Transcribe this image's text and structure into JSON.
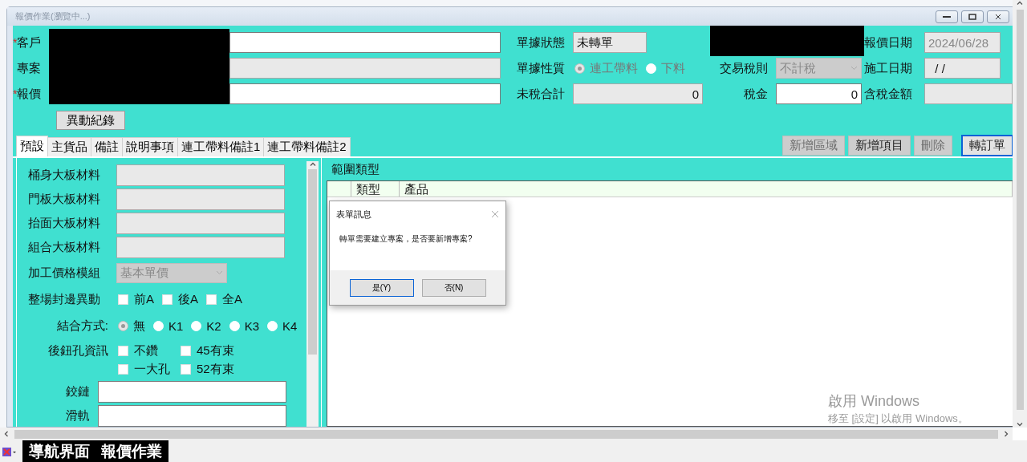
{
  "window": {
    "title": "報價作業(瀏覽中...)"
  },
  "header_fields": [
    {
      "marker": "*",
      "label": "客戶",
      "disabled": false
    },
    {
      "label": "專案",
      "disabled": true
    },
    {
      "marker": "*",
      "label": "報價",
      "disabled": false
    }
  ],
  "history_button": "異動紀錄",
  "status": {
    "label": "單據狀態",
    "value": "未轉單"
  },
  "quote_date": {
    "label": "報價日期",
    "value": "2024/06/28",
    "disabled": true
  },
  "doc_type": {
    "label": "單據性質",
    "disabled": true,
    "options": [
      {
        "label": "連工帶料",
        "selected": true
      },
      {
        "label": "下料",
        "selected": false
      }
    ]
  },
  "tax_rule": {
    "label": "交易稅則",
    "value": "不計稅",
    "disabled": true
  },
  "work_date": {
    "label": "施工日期",
    "value": "/ /"
  },
  "totals": [
    {
      "label": "未稅合計",
      "value": "0",
      "disabled": true
    },
    {
      "label": "稅金",
      "value": "0",
      "disabled": false
    },
    {
      "label": "含稅金額",
      "disabled": true
    }
  ],
  "tabs": [
    {
      "label": "預設",
      "selected": true
    },
    {
      "label": "主貨品",
      "selected": false
    },
    {
      "label": "備註",
      "selected": false
    },
    {
      "label": "說明事項",
      "selected": false
    },
    {
      "label": "連工帶料備註1",
      "selected": false
    },
    {
      "label": "連工帶料備註2",
      "selected": false
    }
  ],
  "actions": [
    {
      "label": "新增區域",
      "disabled": true,
      "focused": false
    },
    {
      "label": "新增項目",
      "disabled": false,
      "focused": false
    },
    {
      "label": "刪除",
      "disabled": true,
      "focused": false
    },
    {
      "label": "轉訂單",
      "disabled": false,
      "focused": true
    }
  ],
  "materials": [
    {
      "label": "桶身大板材料"
    },
    {
      "label": "門板大板材料"
    },
    {
      "label": "抬面大板材料"
    },
    {
      "label": "組合大板材料"
    }
  ],
  "price_module": {
    "label": "加工價格模組",
    "value": "基本單價",
    "disabled": true
  },
  "edge_change": {
    "label": "整場封邊異動",
    "options": [
      {
        "label": "前A",
        "checked": false
      },
      {
        "label": "後A",
        "checked": false
      },
      {
        "label": "全A",
        "checked": false
      }
    ]
  },
  "joining": {
    "label": "結合方式:",
    "options": [
      {
        "label": "無",
        "selected": true
      },
      {
        "label": "K1",
        "selected": false
      },
      {
        "label": "K2",
        "selected": false
      },
      {
        "label": "K3",
        "selected": false
      },
      {
        "label": "K4",
        "selected": false
      }
    ]
  },
  "rear_holes": {
    "label": "後鈕孔資訊",
    "options": [
      {
        "label": "不鑽",
        "checked": false
      },
      {
        "label": "45有束",
        "checked": false
      },
      {
        "label": "一大孔",
        "checked": false
      },
      {
        "label": "52有束",
        "checked": false
      }
    ]
  },
  "hardware": [
    {
      "label": "鉸鏈"
    },
    {
      "label": "滑軌"
    }
  ],
  "range_group": {
    "title": "範圍類型",
    "columns": [
      "類型",
      "產品"
    ]
  },
  "dialog": {
    "title": "表單訊息",
    "message": "轉單需要建立專案，是否要新增專案?",
    "buttons": [
      {
        "label": "是(Y)",
        "default": true
      },
      {
        "label": "否(N)",
        "default": false
      }
    ]
  },
  "activation_notice": {
    "title": "啟用 Windows",
    "message": "移至 [設定] 以啟用 Windows。"
  },
  "taskbar": {
    "items": [
      "導航界面",
      "報價作業"
    ]
  }
}
